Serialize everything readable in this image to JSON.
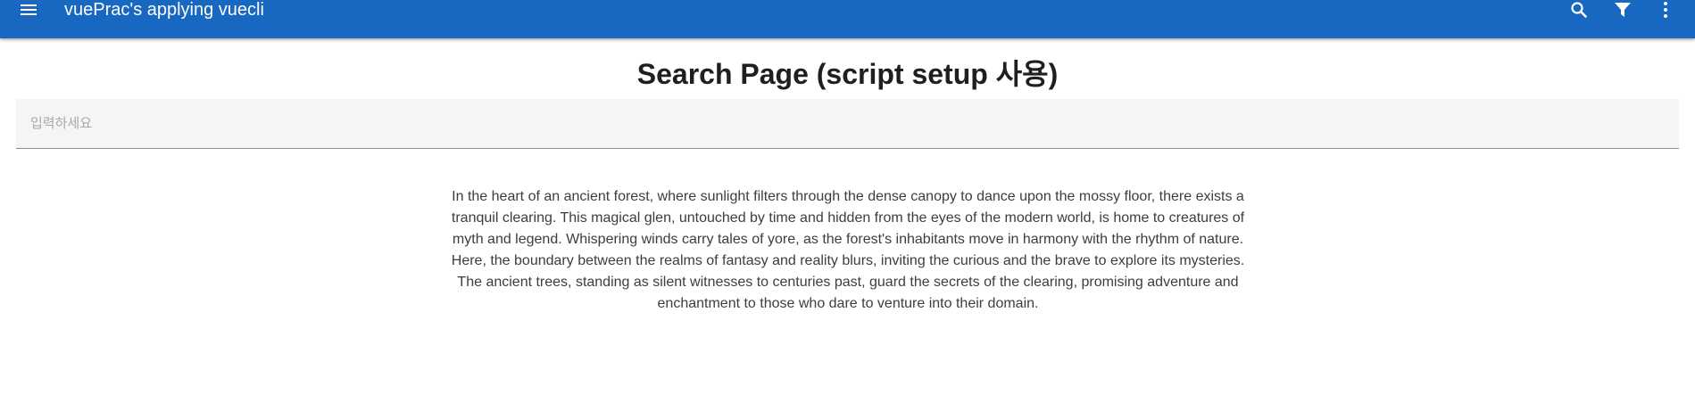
{
  "app_bar": {
    "title": "vuePrac's applying vuecli",
    "background_color": "#1867c0",
    "nav_icon": "menu-icon",
    "actions": [
      {
        "name": "search-button",
        "icon": "magnify-icon"
      },
      {
        "name": "filter-button",
        "icon": "filter-icon"
      },
      {
        "name": "more-button",
        "icon": "dots-vertical-icon"
      }
    ]
  },
  "page": {
    "title": "Search Page (script setup 사용)"
  },
  "search": {
    "value": "",
    "placeholder": "입력하세요"
  },
  "description": "In the heart of an ancient forest, where sunlight filters through the dense canopy to dance upon the mossy floor, there exists a tranquil clearing. This magical glen, untouched by time and hidden from the eyes of the modern world, is home to creatures of myth and legend. Whispering winds carry tales of yore, as the forest's inhabitants move in harmony with the rhythm of nature. Here, the boundary between the realms of fantasy and reality blurs, inviting the curious and the brave to explore its mysteries. The ancient trees, standing as silent witnesses to centuries past, guard the secrets of the clearing, promising adventure and enchantment to those who dare to venture into their domain."
}
